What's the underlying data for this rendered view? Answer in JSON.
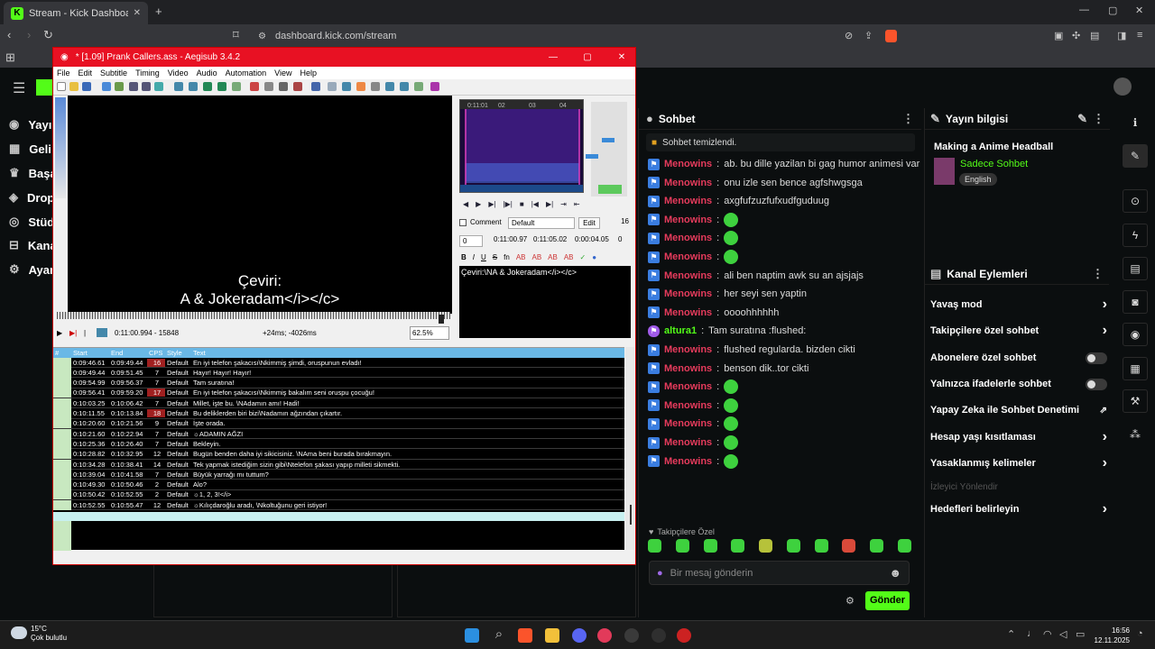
{
  "browser": {
    "tab_title": "Stream - Kick Dashboard",
    "url": "dashboard.kick.com/stream"
  },
  "nav": {
    "items": [
      "Yayı",
      "Geli",
      "Başa",
      "Drop",
      "Stüd",
      "Kana",
      "Ayar"
    ]
  },
  "aegisub": {
    "title": "* [1.09] Prank Callers.ass - Aegisub 3.4.2",
    "menu": [
      "File",
      "Edit",
      "Subtitle",
      "Timing",
      "Video",
      "Audio",
      "Automation",
      "View",
      "Help"
    ],
    "video_subtitle_line1": "Çeviri:",
    "video_subtitle_line2": "A & Jokeradam</i></c>",
    "time_frame": "0:11:00.994 - 15848",
    "offset": "+24ms; -4026ms",
    "zoom": "62.5%",
    "waveform_ticks": [
      "0:11:01",
      "02",
      "03",
      "04"
    ],
    "comment_label": "Comment",
    "style_value": "Default",
    "edit_label": "Edit",
    "margin_value": "16",
    "layer": "0",
    "start_time": "0:11:00.97",
    "end_time": "0:11:05.02",
    "duration": "0:00:04.05",
    "margin2": "0",
    "edit_text": "Çeviri:\\NA & Jokeradam</i></c>",
    "grid_headers": [
      "#",
      "Start",
      "End",
      "CPS",
      "Style",
      "Text"
    ],
    "rows": [
      {
        "start": "0:09:46.61",
        "end": "0:09:49.44",
        "cps": "16",
        "style": "Default",
        "text": "En iyi telefon şakacısı\\Nkimmiş şimdi, oruspunun evladı!",
        "hot": true
      },
      {
        "start": "0:09:49.44",
        "end": "0:09:51.45",
        "cps": "7",
        "style": "Default",
        "text": "Hayır! Hayır! Hayır!",
        "hot": false
      },
      {
        "start": "0:09:54.99",
        "end": "0:09:56.37",
        "cps": "7",
        "style": "Default",
        "text": "Tam suratına!",
        "hot": false
      },
      {
        "start": "0:09:56.41",
        "end": "0:09:59.20",
        "cps": "17",
        "style": "Default",
        "text": "En iyi telefon şakacısı\\Nkimmiş bakalım seni oruspu çocuğu!",
        "hot": true
      },
      {
        "start": "0:10:03.25",
        "end": "0:10:06.42",
        "cps": "7",
        "style": "Default",
        "text": "Millet, işte bu. \\NAdamın amı! Hadi!",
        "hot": false
      },
      {
        "start": "0:10:11.55",
        "end": "0:10:13.84",
        "cps": "18",
        "style": "Default",
        "text": "Bu deliklerden biri bizi\\Nadamın ağzından çıkartır.",
        "hot": true
      },
      {
        "start": "0:10:20.60",
        "end": "0:10:21.56",
        "cps": "9",
        "style": "Default",
        "text": "İşte orada.",
        "hot": false
      },
      {
        "start": "0:10:21.60",
        "end": "0:10:22.94",
        "cps": "7",
        "style": "Default",
        "text": "☼ADAMIN AĞZI",
        "hot": false
      },
      {
        "start": "0:10:25.36",
        "end": "0:10:26.40",
        "cps": "7",
        "style": "Default",
        "text": "Bekleyin.",
        "hot": false
      },
      {
        "start": "0:10:28.82",
        "end": "0:10:32.95",
        "cps": "12",
        "style": "Default",
        "text": "Bugün benden daha iyi sikicisiniz. \\NAma beni burada bırakmayın.",
        "hot": false
      },
      {
        "start": "0:10:34.28",
        "end": "0:10:38.41",
        "cps": "14",
        "style": "Default",
        "text": "Tek yapmak istediğim sizin gibi\\Ntelefon şakası yapıp milleti sikmekti.",
        "hot": false
      },
      {
        "start": "0:10:39.04",
        "end": "0:10:41.58",
        "cps": "7",
        "style": "Default",
        "text": "Büyük yarrağı mı tuttum?",
        "hot": false
      },
      {
        "start": "0:10:49.30",
        "end": "0:10:50.46",
        "cps": "2",
        "style": "Default",
        "text": "Alo?",
        "hot": false
      },
      {
        "start": "0:10:50.42",
        "end": "0:10:52.55",
        "cps": "2",
        "style": "Default",
        "text": "☼1, 2, 3!</i>",
        "hot": false
      },
      {
        "start": "0:10:52.55",
        "end": "0:10:55.47",
        "cps": "12",
        "style": "Default",
        "text": "☼Kılıçdaroğlu aradı, \\Nkoltuğunu geri istiyor!",
        "hot": false
      }
    ]
  },
  "chat": {
    "title": "Sohbet",
    "system": "Sohbet temizlendi.",
    "messages": [
      {
        "user": "Menowins",
        "text": "ab. bu dille yazilan bi gag humor animesi var",
        "emote": false,
        "mod": false
      },
      {
        "user": "Menowins",
        "text": "onu izle sen bence agfshwgsga",
        "emote": false,
        "mod": false
      },
      {
        "user": "Menowins",
        "text": "axgfufzuzfufxudfguduug",
        "emote": false,
        "mod": false
      },
      {
        "user": "Menowins",
        "text": "",
        "emote": true,
        "mod": false
      },
      {
        "user": "Menowins",
        "text": "",
        "emote": true,
        "mod": false
      },
      {
        "user": "Menowins",
        "text": "",
        "emote": true,
        "mod": false
      },
      {
        "user": "Menowins",
        "text": "ali ben naptim awk su an ajsjajs",
        "emote": false,
        "mod": false
      },
      {
        "user": "Menowins",
        "text": "her seyi sen yaptin",
        "emote": false,
        "mod": false
      },
      {
        "user": "Menowins",
        "text": "oooohhhhhh",
        "emote": false,
        "mod": false
      },
      {
        "user": "altura1",
        "text": "Tam suratına :flushed:",
        "emote": false,
        "mod": true
      },
      {
        "user": "Menowins",
        "text": "flushed regularda. bizden cikti",
        "emote": false,
        "mod": false
      },
      {
        "user": "Menowins",
        "text": "benson dik..tor cikti",
        "emote": false,
        "mod": false
      },
      {
        "user": "Menowins",
        "text": "",
        "emote": true,
        "mod": false
      },
      {
        "user": "Menowins",
        "text": "",
        "emote": true,
        "mod": false
      },
      {
        "user": "Menowins",
        "text": "",
        "emote": true,
        "mod": false
      },
      {
        "user": "Menowins",
        "text": "",
        "emote": true,
        "mod": false
      },
      {
        "user": "Menowins",
        "text": "",
        "emote": true,
        "mod": false
      }
    ],
    "followers_only": "Takipçilere Özel",
    "input_placeholder": "Bir mesaj gönderin",
    "send_label": "Gönder"
  },
  "stream_info": {
    "title": "Yayın bilgisi",
    "stream_title": "Making a Anime Headball",
    "category": "Sadece Sohbet",
    "language": "English"
  },
  "channel_actions": {
    "title": "Kanal Eylemleri",
    "items": [
      {
        "label": "Yavaş mod",
        "control": "chevron"
      },
      {
        "label": "Takipçilere özel sohbet",
        "control": "chevron"
      },
      {
        "label": "Abonelere özel sohbet",
        "control": "toggle"
      },
      {
        "label": "Yalnızca ifadelerle sohbet",
        "control": "toggle"
      },
      {
        "label": "Yapay Zeka ile Sohbet Denetimi",
        "control": "external"
      },
      {
        "label": "Hesap yaşı kısıtlaması",
        "control": "chevron"
      },
      {
        "label": "Yasaklanmış kelimeler",
        "control": "chevron"
      },
      {
        "label": "İzleyici Yönlendir",
        "control": "disabled"
      },
      {
        "label": "Hedefleri belirleyin",
        "control": "chevron"
      }
    ]
  },
  "taskbar": {
    "temp": "15°C",
    "weather": "Çok bulutlu",
    "time": "16:56",
    "date": "12.11.2025"
  },
  "colors": {
    "kick_green": "#53fc18",
    "aegisub_title": "#e81123",
    "username": "#e63b5c"
  }
}
